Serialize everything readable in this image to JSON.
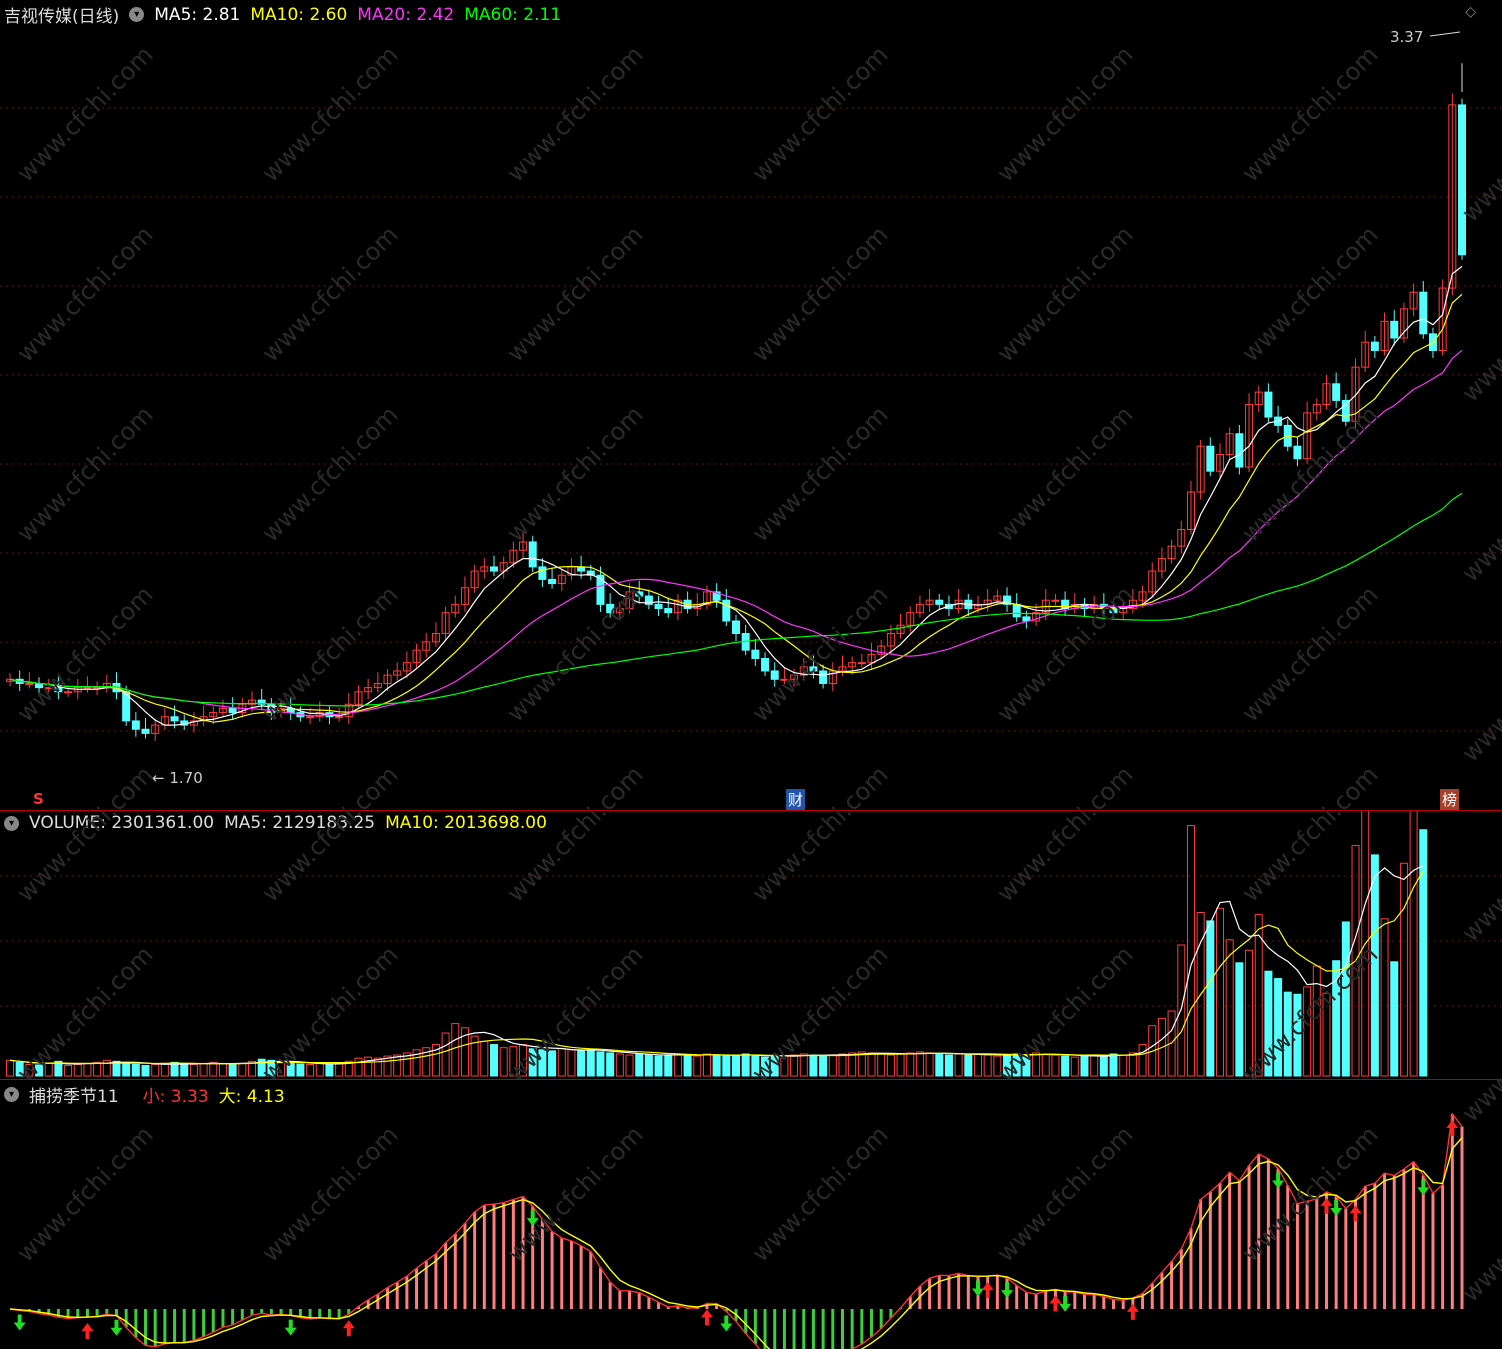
{
  "price": {
    "title": "吉视传媒(日线)",
    "ma5": {
      "label": "MA5:",
      "value": "2.81",
      "color": "#ffffff"
    },
    "ma10": {
      "label": "MA10:",
      "value": "2.60",
      "color": "#ffff00"
    },
    "ma20": {
      "label": "MA20:",
      "value": "2.42",
      "color": "#ff33ff"
    },
    "ma60": {
      "label": "MA60:",
      "value": "2.11",
      "color": "#00ff00"
    },
    "high_label": "3.37",
    "low_label": "1.70",
    "tag_s": "S",
    "tag_cai": "财",
    "tag_bang": "榜"
  },
  "volume": {
    "label": "VOLUME:",
    "value": "2301361.00",
    "ma5_label": "MA5:",
    "ma5_value": "2129183.25",
    "ma10_label": "MA10:",
    "ma10_value": "2013698.00"
  },
  "indicator": {
    "name": "捕捞季节11",
    "small_label": "小:",
    "small_value": "3.33",
    "big_label": "大:",
    "big_value": "4.13"
  },
  "watermark": "www.cfchi.com",
  "chart_data": [
    {
      "type": "candlestick",
      "ylim": [
        1.6,
        3.45
      ],
      "close": [
        1.89,
        1.88,
        1.88,
        1.87,
        1.87,
        1.86,
        1.86,
        1.87,
        1.87,
        1.87,
        1.88,
        1.86,
        1.79,
        1.77,
        1.76,
        1.78,
        1.8,
        1.79,
        1.78,
        1.79,
        1.8,
        1.81,
        1.82,
        1.81,
        1.83,
        1.84,
        1.83,
        1.81,
        1.82,
        1.81,
        1.8,
        1.8,
        1.81,
        1.8,
        1.8,
        1.83,
        1.86,
        1.87,
        1.88,
        1.9,
        1.91,
        1.93,
        1.96,
        1.98,
        2.0,
        2.05,
        2.07,
        2.11,
        2.15,
        2.16,
        2.15,
        2.17,
        2.2,
        2.22,
        2.16,
        2.13,
        2.12,
        2.14,
        2.16,
        2.15,
        2.14,
        2.07,
        2.05,
        2.06,
        2.1,
        2.09,
        2.07,
        2.06,
        2.05,
        2.08,
        2.06,
        2.07,
        2.1,
        2.08,
        2.03,
        2.0,
        1.96,
        1.94,
        1.91,
        1.89,
        1.89,
        1.9,
        1.92,
        1.91,
        1.88,
        1.91,
        1.92,
        1.93,
        1.93,
        1.95,
        1.97,
        2.0,
        2.02,
        2.05,
        2.07,
        2.08,
        2.07,
        2.06,
        2.08,
        2.06,
        2.07,
        2.08,
        2.09,
        2.07,
        2.04,
        2.03,
        2.05,
        2.08,
        2.08,
        2.06,
        2.07,
        2.06,
        2.07,
        2.06,
        2.05,
        2.06,
        2.08,
        2.1,
        2.15,
        2.18,
        2.21,
        2.25,
        2.34,
        2.45,
        2.39,
        2.43,
        2.48,
        2.4,
        2.55,
        2.58,
        2.52,
        2.5,
        2.45,
        2.42,
        2.53,
        2.55,
        2.6,
        2.56,
        2.51,
        2.64,
        2.7,
        2.68,
        2.75,
        2.71,
        2.78,
        2.82,
        2.72,
        2.68,
        2.83,
        3.27,
        2.91
      ]
    },
    {
      "type": "bar",
      "name": "VOLUME",
      "ylim": [
        0,
        2500000
      ],
      "values": [
        150,
        130,
        110,
        105,
        120,
        140,
        100,
        110,
        120,
        130,
        150,
        140,
        120,
        110,
        100,
        110,
        120,
        130,
        110,
        110,
        120,
        130,
        120,
        110,
        120,
        140,
        160,
        150,
        130,
        120,
        115,
        110,
        120,
        110,
        120,
        140,
        170,
        180,
        170,
        190,
        200,
        220,
        250,
        270,
        300,
        410,
        500,
        460,
        380,
        330,
        300,
        270,
        280,
        300,
        260,
        250,
        240,
        260,
        250,
        240,
        250,
        230,
        220,
        210,
        200,
        210,
        200,
        190,
        200,
        210,
        200,
        190,
        210,
        200,
        190,
        200,
        210,
        190,
        180,
        190,
        190,
        200,
        210,
        200,
        190,
        200,
        210,
        220,
        230,
        220,
        210,
        200,
        210,
        220,
        230,
        220,
        210,
        200,
        210,
        200,
        210,
        200,
        190,
        200,
        210,
        200,
        220,
        210,
        200,
        190,
        180,
        190,
        200,
        190,
        210,
        200,
        220,
        300,
        480,
        550,
        620,
        1250,
        2390,
        1560,
        1480,
        1600,
        1300,
        1080,
        1200,
        1540,
        1000,
        930,
        800,
        780,
        850,
        1050,
        790,
        1100,
        1470,
        2200,
        2650,
        2110,
        1500,
        1090,
        2030,
        3080,
        2350
      ]
    },
    {
      "type": "bar",
      "name": "捕捞季节11",
      "series": [
        {
          "name": "小",
          "value": 3.33
        },
        {
          "name": "大",
          "value": 4.13
        }
      ]
    }
  ]
}
